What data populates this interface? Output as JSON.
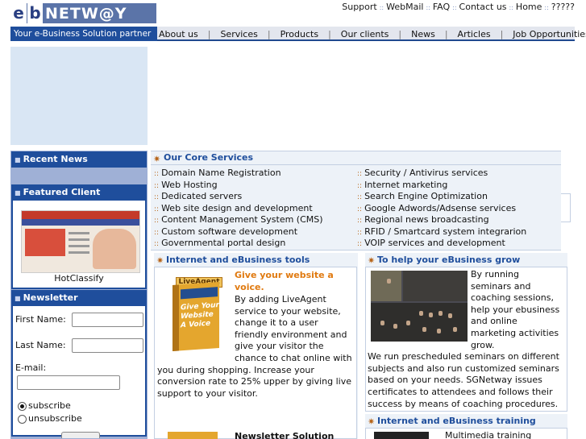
{
  "logo": {
    "text_e": "e",
    "text_b": "b",
    "text_net": "NETW@Y"
  },
  "top_links": [
    "Support",
    "WebMail",
    "FAQ",
    "Contact us",
    "Home",
    "?????"
  ],
  "tagline": "Your e-Business Solution partner",
  "menu": [
    "About us",
    "Services",
    "Products",
    "Our clients",
    "News",
    "Articles",
    "Job Opportunities"
  ],
  "left": {
    "recent_news": "Recent News",
    "featured_client": "Featured Client",
    "featured_caption": "HotClassify",
    "newsletter": "Newsletter",
    "first_name_label": "First Name:",
    "last_name_label": "Last Name:",
    "email_label": "E-mail:",
    "subscribe_label": "subscribe",
    "unsubscribe_label": "unsubscribe"
  },
  "core": {
    "title": "Our Core Services",
    "left_items": [
      "Domain Name Registration",
      "Web Hosting",
      "Dedicated servers",
      "Web site design and development",
      "Content Management System (CMS)",
      "Custom software development",
      "Governmental portal design"
    ],
    "right_items": [
      "Security / Antivirus services",
      "Internet marketing",
      "Search Engine Optimization",
      "Google Adwords/Adsense services",
      "Regional news broadcasting",
      "RFID / Smartcard system integrarion",
      "VOIP services and development"
    ]
  },
  "tools": {
    "title": "Internet and eBusiness tools",
    "item_title_1": "Give your website a",
    "item_title_2": "voice.",
    "body_lines": [
      "By adding LiveAgent",
      "service to your website,",
      "change it to a user",
      "friendly environment and",
      "give your visitor the",
      "chance to chat online with"
    ],
    "body_full_lines": [
      "you during shopping. Increase your",
      "conversion rate to 25% upper by giving live",
      "support to your visitor."
    ],
    "next_title": "Newsletter Solution",
    "box_logo": "LiveAgent",
    "box_text": "Give Your Website A Voice"
  },
  "grow": {
    "title": "To help your eBusiness grow",
    "side_lines": [
      "By running",
      "seminars and",
      "coaching sessions,",
      "help your ebusiness",
      "and online",
      "marketing activities",
      "grow."
    ],
    "full_lines": [
      "We run prescheduled seminars on different",
      "subjects and also run customized seminars",
      "based on your needs. SGNetway issues",
      "certificates to attendees and follows their",
      "success by means of coaching procedures."
    ]
  },
  "training": {
    "title": "Internet and eBusiness training",
    "first_line": "Multimedia training"
  },
  "colors": {
    "brand_blue": "#1f4e9c",
    "accent_orange": "#e07a10",
    "panel_bg": "#edf2f8"
  }
}
